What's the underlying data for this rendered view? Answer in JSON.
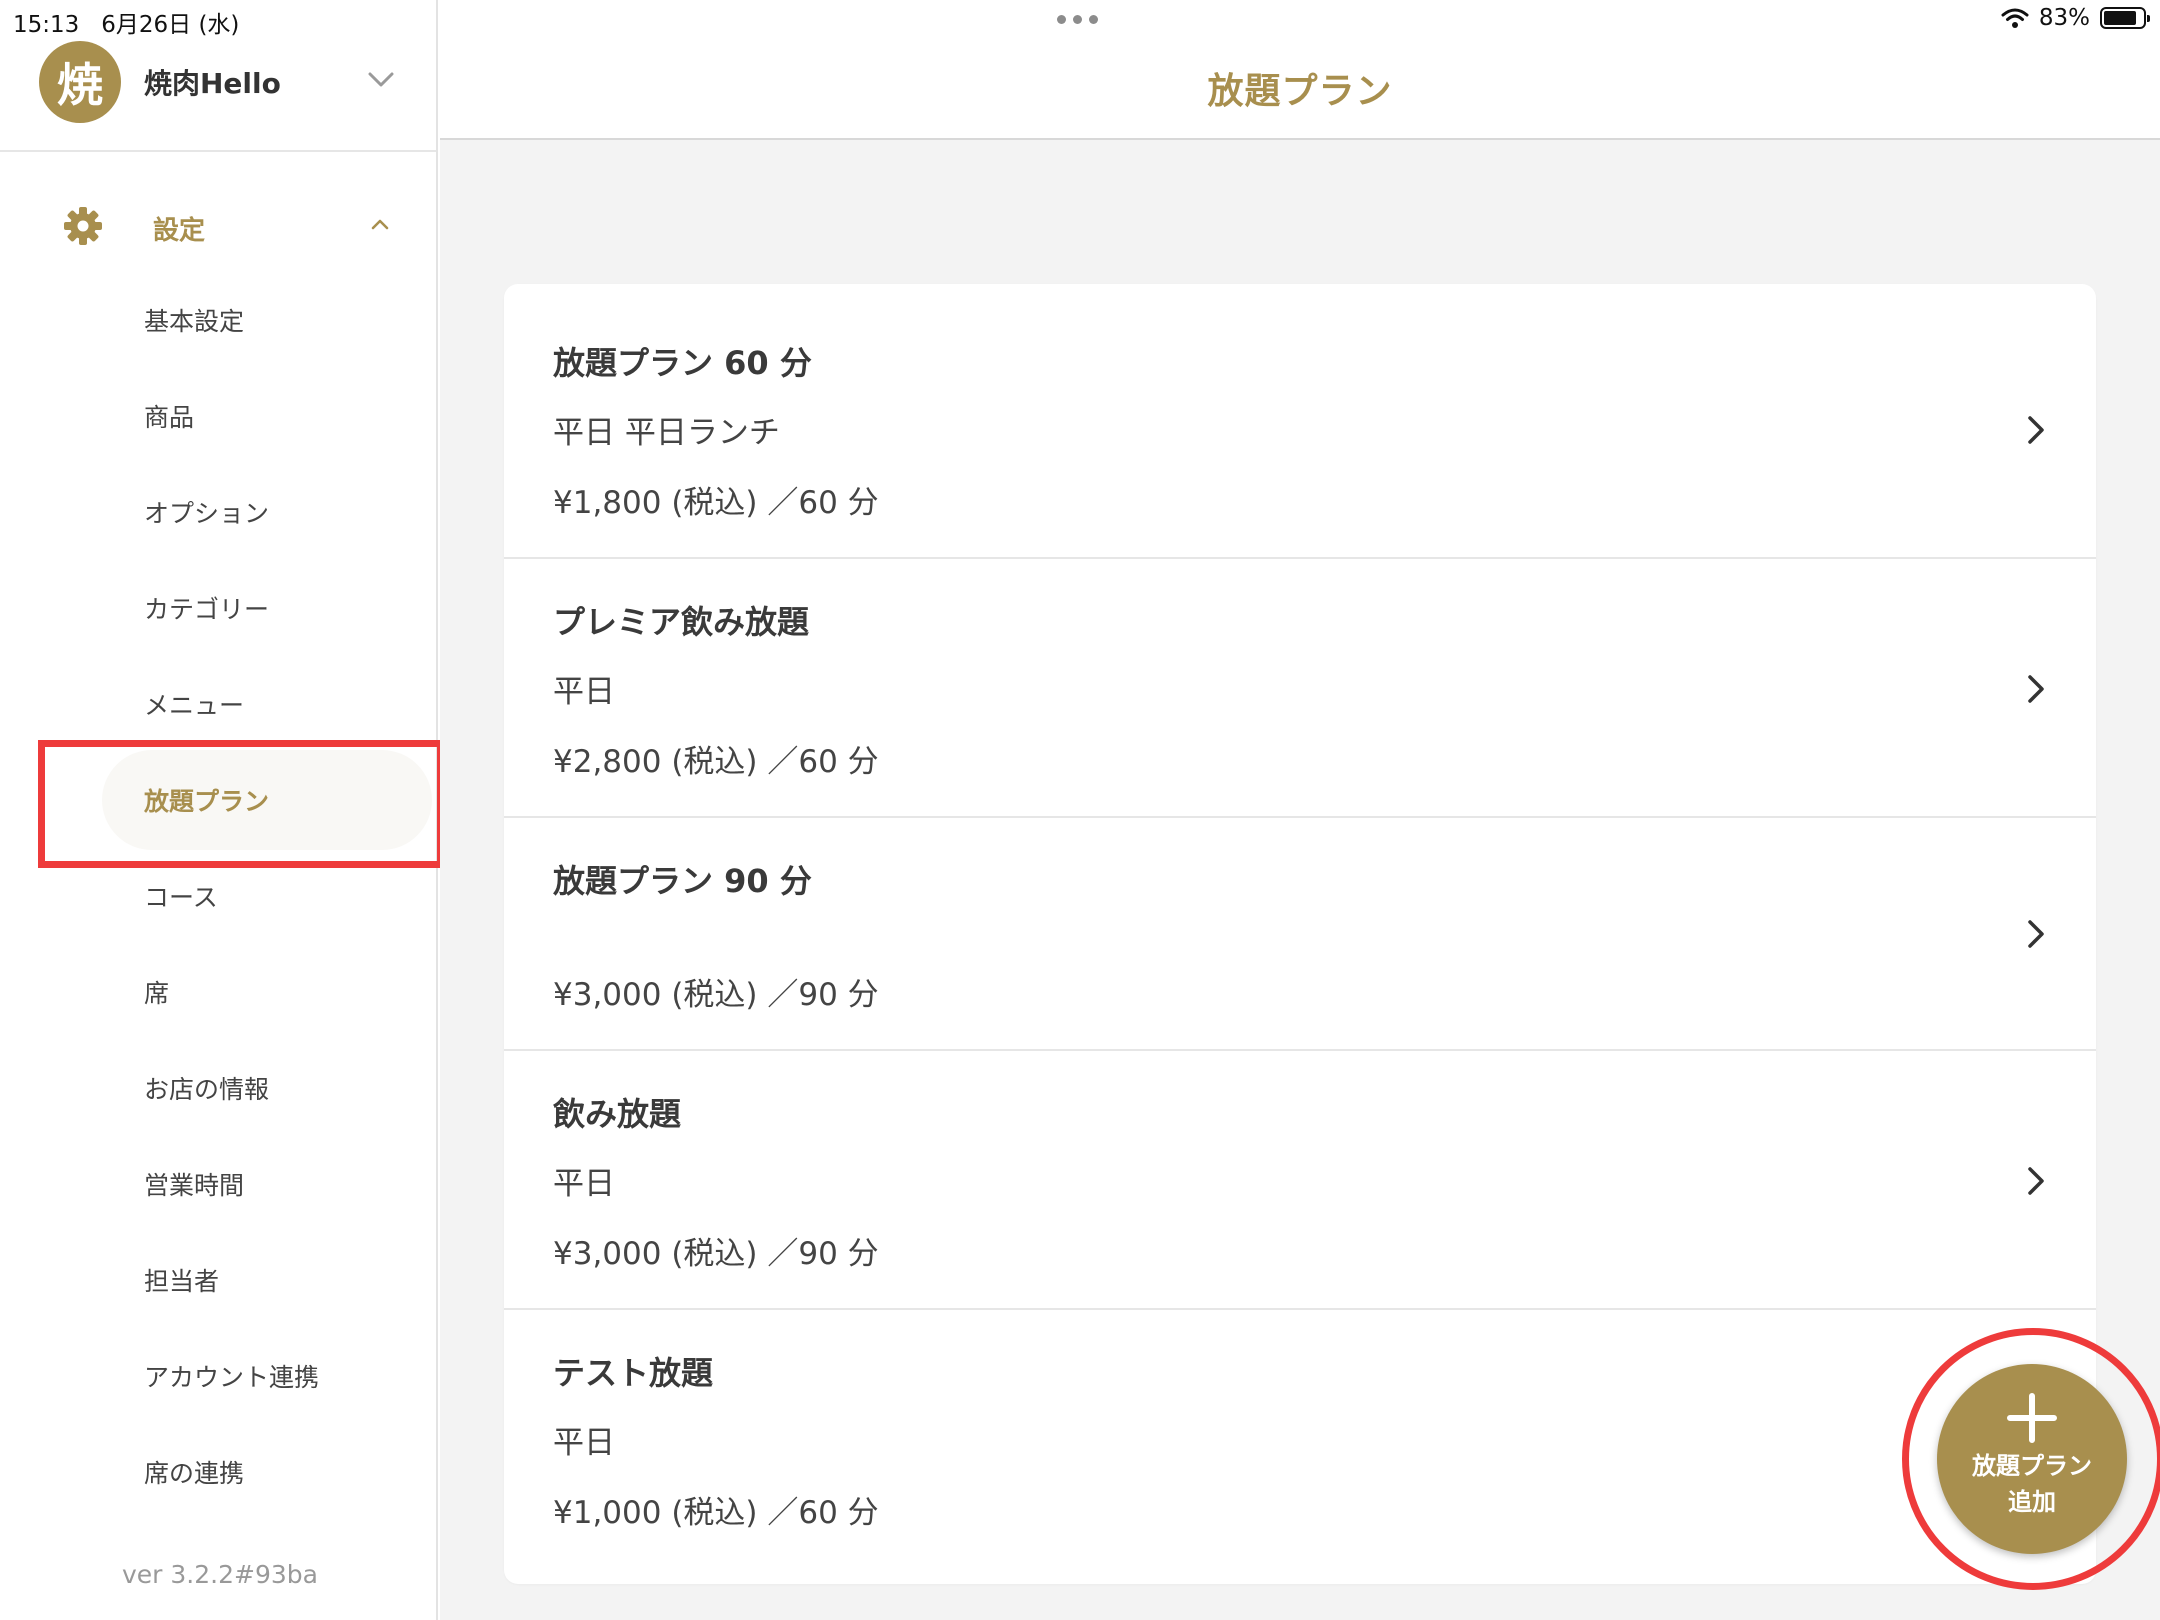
{
  "status_bar": {
    "time": "15:13",
    "date": "6月26日 (水)",
    "battery_percent": "83%",
    "battery_level": 0.83
  },
  "store": {
    "avatar_char": "焼",
    "name": "焼肉Hello"
  },
  "sidebar": {
    "settings_label": "設定",
    "items": [
      {
        "label": "基本設定"
      },
      {
        "label": "商品"
      },
      {
        "label": "オプション"
      },
      {
        "label": "カテゴリー"
      },
      {
        "label": "メニュー"
      },
      {
        "label": "放題プラン",
        "active": true
      },
      {
        "label": "コース"
      },
      {
        "label": "席"
      },
      {
        "label": "お店の情報"
      },
      {
        "label": "営業時間"
      },
      {
        "label": "担当者"
      },
      {
        "label": "アカウント連携"
      },
      {
        "label": "席の連携"
      }
    ],
    "version": "ver 3.2.2#93ba"
  },
  "page": {
    "title": "放題プラン"
  },
  "plans": [
    {
      "name": "放題プラン 60 分",
      "days": "平日 平日ランチ",
      "price": "¥1,800 (税込) ／60 分"
    },
    {
      "name": "プレミア飲み放題",
      "days": "平日",
      "price": "¥2,800 (税込) ／60 分"
    },
    {
      "name": "放題プラン 90 分",
      "days": "",
      "price": "¥3,000 (税込) ／90 分"
    },
    {
      "name": "飲み放題",
      "days": "平日",
      "price": "¥3,000 (税込) ／90 分"
    },
    {
      "name": "テスト放題",
      "days": "平日",
      "price": "¥1,000 (税込) ／60 分"
    }
  ],
  "fab": {
    "line1": "放題プラン",
    "line2": "追加"
  },
  "colors": {
    "accent": "#a88f4e",
    "highlight": "#ee3b3b",
    "background": "#f3f3f3"
  }
}
